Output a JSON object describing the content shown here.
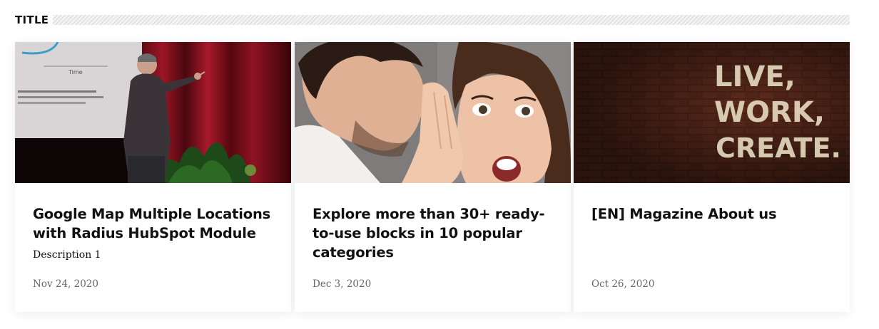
{
  "section": {
    "title": "TITLE"
  },
  "cards": [
    {
      "title": "Google Map Multiple Locations with Radius HubSpot Module",
      "description": "Description 1",
      "date": "Nov 24, 2020",
      "image": "speaker-on-stage-photo",
      "image_text": "Time"
    },
    {
      "title": "Explore more than 30+ ready-to-use blocks in 10 popular categories",
      "description": "",
      "date": "Dec 3, 2020",
      "image": "whispering-secret-photo"
    },
    {
      "title": "[EN] Magazine About us",
      "description": "",
      "date": "Oct 26, 2020",
      "image": "brick-wall-text-photo",
      "image_text": [
        "LIVE,",
        "WORK,",
        "CREATE."
      ]
    }
  ]
}
